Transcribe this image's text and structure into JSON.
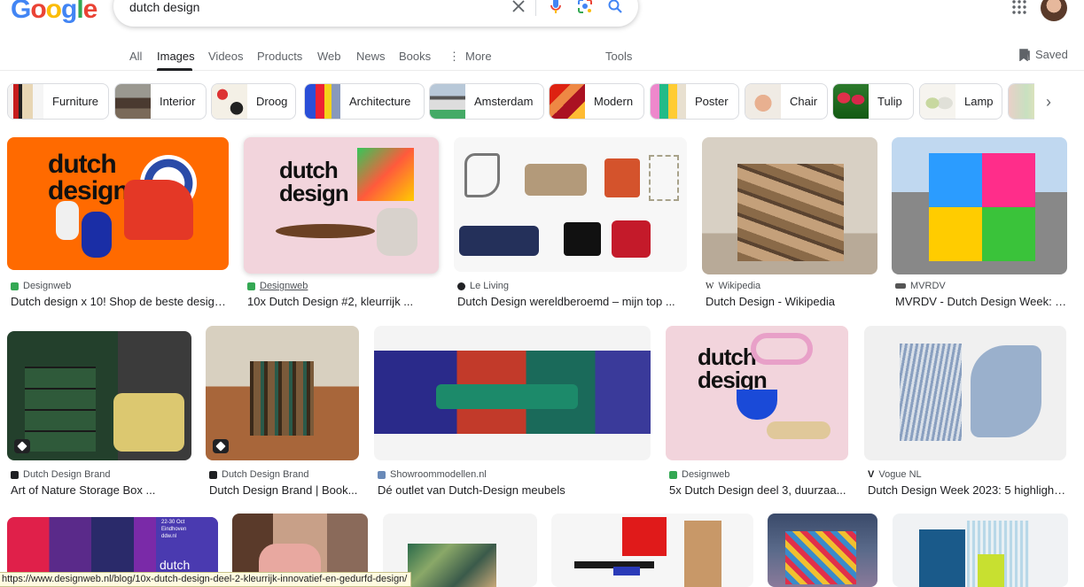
{
  "logo": [
    "G",
    "o",
    "o",
    "g",
    "l",
    "e"
  ],
  "logo_colors": [
    "#4285F4",
    "#EA4335",
    "#FBBC05",
    "#4285F4",
    "#34A853",
    "#EA4335"
  ],
  "search": {
    "query": "dutch design"
  },
  "tabs": [
    {
      "label": "All"
    },
    {
      "label": "Images"
    },
    {
      "label": "Videos"
    },
    {
      "label": "Products"
    },
    {
      "label": "Web"
    },
    {
      "label": "News"
    },
    {
      "label": "Books"
    },
    {
      "label": "More"
    }
  ],
  "tools_label": "Tools",
  "saved_label": "Saved",
  "chips": [
    {
      "label": "Furniture"
    },
    {
      "label": "Interior"
    },
    {
      "label": "Droog"
    },
    {
      "label": "Architecture"
    },
    {
      "label": "Amsterdam"
    },
    {
      "label": "Modern"
    },
    {
      "label": "Poster"
    },
    {
      "label": "Chair"
    },
    {
      "label": "Tulip"
    },
    {
      "label": "Lamp"
    }
  ],
  "results": [
    {
      "source": "Designweb",
      "title": "Dutch design x 10! Shop de beste design ..."
    },
    {
      "source": "Designweb",
      "title": "10x Dutch Design #2, kleurrijk ..."
    },
    {
      "source": "Le Living",
      "title": "Dutch Design wereldberoemd – mijn top ..."
    },
    {
      "source": "Wikipedia",
      "title": "Dutch Design - Wikipedia"
    },
    {
      "source": "MVRDV",
      "title": "MVRDV - Dutch Design Week: T..."
    },
    {
      "source": "Dutch Design Brand",
      "title": "Art of Nature Storage Box ..."
    },
    {
      "source": "Dutch Design Brand",
      "title": "Dutch Design Brand | Book..."
    },
    {
      "source": "Showroommodellen.nl",
      "title": "Dé outlet van Dutch-Design meubels"
    },
    {
      "source": "Designweb",
      "title": "5x Dutch Design deel 3, duurzaa..."
    },
    {
      "source": "Vogue NL",
      "title": "Dutch Design Week 2023: 5 highlights..."
    }
  ],
  "image_texts": {
    "dutch_design_1": [
      "dutch",
      "design"
    ],
    "dutch_design_2": [
      "dutch",
      "design"
    ],
    "dutch_design_3": [
      "dutch",
      "design"
    ],
    "ddw_poster": [
      "22-30 Oct",
      "Eindhoven",
      "ddw.nl",
      "dutch"
    ]
  },
  "status_url": "https://www.designweb.nl/blog/10x-dutch-design-deel-2-kleurrijk-innovatief-en-gedurfd-design/",
  "colors": {
    "accent_green": "#34a853",
    "text_primary": "#202124",
    "text_secondary": "#4d5156"
  }
}
